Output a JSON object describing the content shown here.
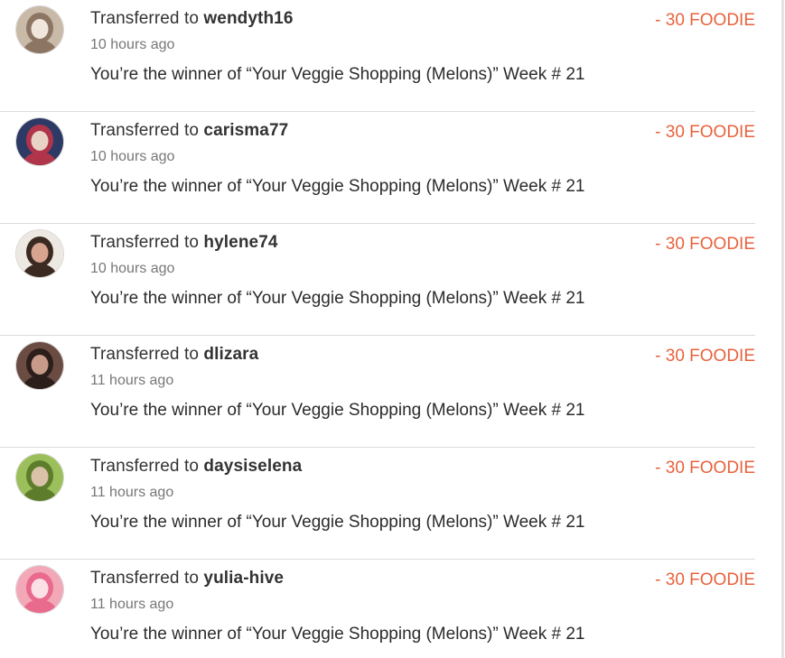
{
  "transfers": [
    {
      "prefix": "Transferred to",
      "username": "wendyth16",
      "time": "10 hours ago",
      "description": "You’re the winner of “Your Veggie Shopping (Melons)” Week # 21",
      "amount": "- 30 FOODIE",
      "avatar_colors": [
        "#c9b9a7",
        "#8d7564",
        "#f1e6dc"
      ]
    },
    {
      "prefix": "Transferred to",
      "username": "carisma77",
      "time": "10 hours ago",
      "description": "You’re the winner of “Your Veggie Shopping (Melons)” Week # 21",
      "amount": "- 30 FOODIE",
      "avatar_colors": [
        "#2e3a66",
        "#b0354a",
        "#e9d3c7"
      ]
    },
    {
      "prefix": "Transferred to",
      "username": "hylene74",
      "time": "10 hours ago",
      "description": "You’re the winner of “Your Veggie Shopping (Melons)” Week # 21",
      "amount": "- 30 FOODIE",
      "avatar_colors": [
        "#ede8e2",
        "#3a2a22",
        "#d7a48f"
      ]
    },
    {
      "prefix": "Transferred to",
      "username": "dlizara",
      "time": "11 hours ago",
      "description": "You’re the winner of “Your Veggie Shopping (Melons)” Week # 21",
      "amount": "- 30 FOODIE",
      "avatar_colors": [
        "#6b4c43",
        "#2c1e1b",
        "#c79a8a"
      ]
    },
    {
      "prefix": "Transferred to",
      "username": "daysiselena",
      "time": "11 hours ago",
      "description": "You’re the winner of “Your Veggie Shopping (Melons)” Week # 21",
      "amount": "- 30 FOODIE",
      "avatar_colors": [
        "#9bbf5a",
        "#5e7d2c",
        "#d9c2a8"
      ]
    },
    {
      "prefix": "Transferred to",
      "username": "yulia-hive",
      "time": "11 hours ago",
      "description": "You’re the winner of “Your Veggie Shopping (Melons)” Week # 21",
      "amount": "- 30 FOODIE",
      "avatar_colors": [
        "#f3a8b8",
        "#e96a8d",
        "#fbe1e6"
      ]
    }
  ],
  "colors": {
    "amount": "#e8623c",
    "text": "#333333",
    "muted": "#777777",
    "divider": "#dcdcdc"
  }
}
